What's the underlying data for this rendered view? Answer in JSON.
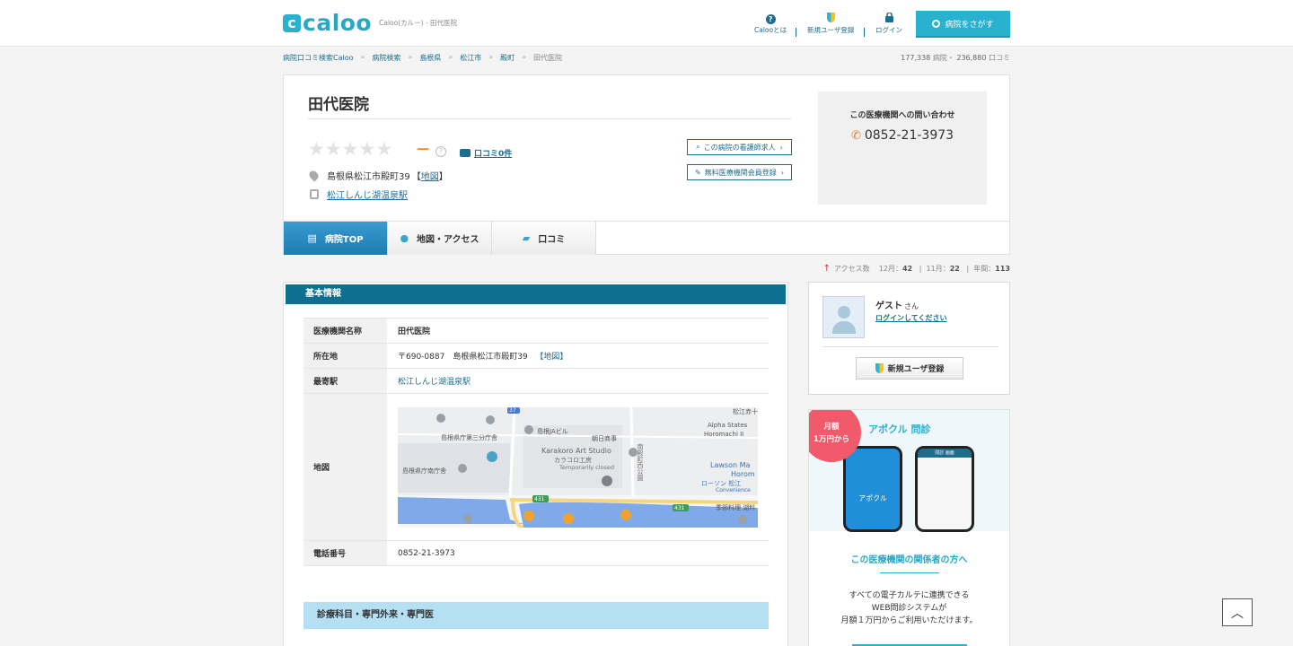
{
  "header": {
    "logo_mark": "c",
    "logo_text": "caloo",
    "logo_sub": "Caloo(カルー) - 田代医院",
    "nav": [
      {
        "label": "Calooとは",
        "icon": "question-circle-icon"
      },
      {
        "label": "新規ユーザ登録",
        "icon": "leaf-icon"
      },
      {
        "label": "ログイン",
        "icon": "lock-icon"
      }
    ],
    "search_label": "病院をさがす"
  },
  "breadcrumb": [
    "病院口コミ検索Caloo",
    "病院検索",
    "島根県",
    "松江市",
    "殿町",
    "田代医院"
  ],
  "counts": {
    "hospitals": "177,338",
    "hospitals_unit": "病院・",
    "reviews": "236,880",
    "reviews_unit": "口コミ"
  },
  "hospital": {
    "name": "田代医院",
    "rating_dash": "—",
    "help": "?",
    "review_link": "口コミ0件",
    "address": "島根県松江市殿町39",
    "map_link": "地図",
    "station": "松江しんじ湖温泉駅",
    "btn_nurse": "この病院の看護師求人",
    "btn_register": "無料医療機関会員登録",
    "contact_title": "この医療機関への問い合わせ",
    "contact_tel": "0852-21-3973"
  },
  "tabs": [
    {
      "label": "病院TOP",
      "icon": "hospital-icon"
    },
    {
      "label": "地図・アクセス",
      "icon": "map-pin-icon"
    },
    {
      "label": "口コミ",
      "icon": "comment-icon"
    }
  ],
  "access": {
    "label": "アクセス数",
    "dec_label": "12月：",
    "dec": "42",
    "nov_label": "11月：",
    "nov": "22",
    "year_label": "年間：",
    "year": "113"
  },
  "basic_info": {
    "title": "基本情報",
    "rows": {
      "name_k": "医療機関名称",
      "name_v": "田代医院",
      "addr_k": "所在地",
      "addr_v": "〒690-0887　島根県松江市殿町39",
      "addr_link": "【地図】",
      "station_k": "最寄駅",
      "station_v": "松江しんじ湖温泉駅",
      "map_k": "地図",
      "tel_k": "電話番号",
      "tel_v": "0852-21-3973"
    },
    "map_labels": {
      "a": "島根県庁第三分庁舎",
      "b": "島根JAビル",
      "c": "朝日商事",
      "d": "Karakoro Art Studio",
      "e": "カラコロ工房",
      "f": "Temporarily closed",
      "g": "島根県庁南庁舎",
      "h": "Alpha States",
      "i": "Horomachi II",
      "j": "Lawson Ma",
      "k": "Horom",
      "l": "ローソン 松江",
      "m": "Convenience",
      "n": "季節料理 湖料",
      "o": "南殿町西公園",
      "p": "松江赤十",
      "r1": "431",
      "r2": "431",
      "r3": "37"
    }
  },
  "sub_section": "診療科目・専門外来・専門医",
  "guest": {
    "name": "ゲスト",
    "suffix": "さん",
    "login": "ログインしてください",
    "register": "新規ユーザ登録"
  },
  "ad": {
    "badge_line1": "月額",
    "badge_line2": "1万円から",
    "brand": "アポクル 問診",
    "phone_brand": "アポクル",
    "phone_header": "問診 画面",
    "heading": "この医療機関の関係者の方へ",
    "text1": "すべての電子カルテに連携できる",
    "text2": "WEB問診システムが",
    "text3": "月額１万円からご利用いただけます。"
  },
  "totop": "︿",
  "colors": {
    "brand": "#29b2cf",
    "section": "#0e6f8f",
    "link": "#1b6c8e",
    "accent": "#f08c2a"
  }
}
